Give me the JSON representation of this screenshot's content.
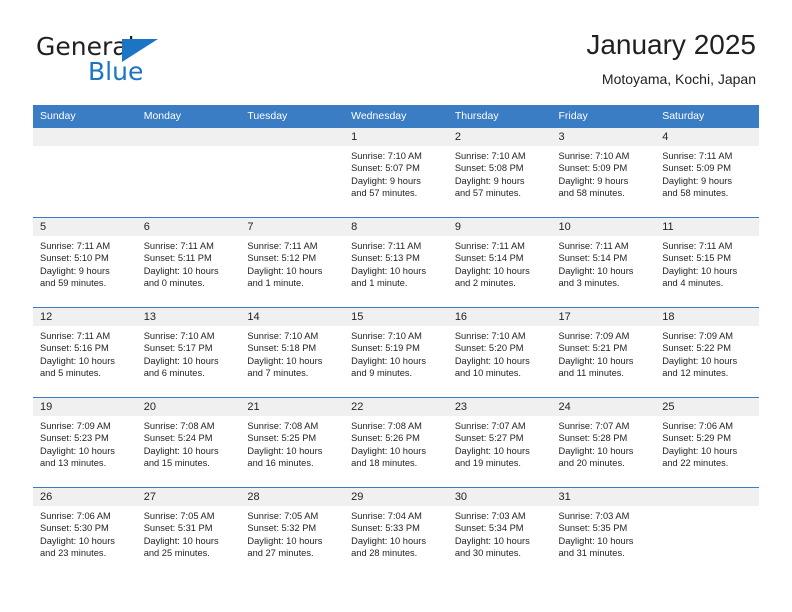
{
  "brand": {
    "name_part1": "General",
    "name_part2": "Blue",
    "triangle_icon": "triangle-icon",
    "colors": {
      "accent": "#1b74c4",
      "text": "#231f20"
    }
  },
  "header": {
    "title": "January 2025",
    "subtitle": "Motoyama, Kochi, Japan"
  },
  "theme": {
    "header_row_bg": "#3b7dc4",
    "daynum_bg": "#f0f0f0",
    "row_divider": "#3b7dc4",
    "page_bg": "#ffffff"
  },
  "weekday_headers": [
    "Sunday",
    "Monday",
    "Tuesday",
    "Wednesday",
    "Thursday",
    "Friday",
    "Saturday"
  ],
  "weeks": [
    [
      {
        "day": "",
        "sunrise": "",
        "sunset": "",
        "daylight_1": "",
        "daylight_2": "",
        "blank": true
      },
      {
        "day": "",
        "sunrise": "",
        "sunset": "",
        "daylight_1": "",
        "daylight_2": "",
        "blank": true
      },
      {
        "day": "",
        "sunrise": "",
        "sunset": "",
        "daylight_1": "",
        "daylight_2": "",
        "blank": true
      },
      {
        "day": "1",
        "sunrise": "Sunrise: 7:10 AM",
        "sunset": "Sunset: 5:07 PM",
        "daylight_1": "Daylight: 9 hours",
        "daylight_2": "and 57 minutes.",
        "blank": false
      },
      {
        "day": "2",
        "sunrise": "Sunrise: 7:10 AM",
        "sunset": "Sunset: 5:08 PM",
        "daylight_1": "Daylight: 9 hours",
        "daylight_2": "and 57 minutes.",
        "blank": false
      },
      {
        "day": "3",
        "sunrise": "Sunrise: 7:10 AM",
        "sunset": "Sunset: 5:09 PM",
        "daylight_1": "Daylight: 9 hours",
        "daylight_2": "and 58 minutes.",
        "blank": false
      },
      {
        "day": "4",
        "sunrise": "Sunrise: 7:11 AM",
        "sunset": "Sunset: 5:09 PM",
        "daylight_1": "Daylight: 9 hours",
        "daylight_2": "and 58 minutes.",
        "blank": false
      }
    ],
    [
      {
        "day": "5",
        "sunrise": "Sunrise: 7:11 AM",
        "sunset": "Sunset: 5:10 PM",
        "daylight_1": "Daylight: 9 hours",
        "daylight_2": "and 59 minutes.",
        "blank": false
      },
      {
        "day": "6",
        "sunrise": "Sunrise: 7:11 AM",
        "sunset": "Sunset: 5:11 PM",
        "daylight_1": "Daylight: 10 hours",
        "daylight_2": "and 0 minutes.",
        "blank": false
      },
      {
        "day": "7",
        "sunrise": "Sunrise: 7:11 AM",
        "sunset": "Sunset: 5:12 PM",
        "daylight_1": "Daylight: 10 hours",
        "daylight_2": "and 1 minute.",
        "blank": false
      },
      {
        "day": "8",
        "sunrise": "Sunrise: 7:11 AM",
        "sunset": "Sunset: 5:13 PM",
        "daylight_1": "Daylight: 10 hours",
        "daylight_2": "and 1 minute.",
        "blank": false
      },
      {
        "day": "9",
        "sunrise": "Sunrise: 7:11 AM",
        "sunset": "Sunset: 5:14 PM",
        "daylight_1": "Daylight: 10 hours",
        "daylight_2": "and 2 minutes.",
        "blank": false
      },
      {
        "day": "10",
        "sunrise": "Sunrise: 7:11 AM",
        "sunset": "Sunset: 5:14 PM",
        "daylight_1": "Daylight: 10 hours",
        "daylight_2": "and 3 minutes.",
        "blank": false
      },
      {
        "day": "11",
        "sunrise": "Sunrise: 7:11 AM",
        "sunset": "Sunset: 5:15 PM",
        "daylight_1": "Daylight: 10 hours",
        "daylight_2": "and 4 minutes.",
        "blank": false
      }
    ],
    [
      {
        "day": "12",
        "sunrise": "Sunrise: 7:11 AM",
        "sunset": "Sunset: 5:16 PM",
        "daylight_1": "Daylight: 10 hours",
        "daylight_2": "and 5 minutes.",
        "blank": false
      },
      {
        "day": "13",
        "sunrise": "Sunrise: 7:10 AM",
        "sunset": "Sunset: 5:17 PM",
        "daylight_1": "Daylight: 10 hours",
        "daylight_2": "and 6 minutes.",
        "blank": false
      },
      {
        "day": "14",
        "sunrise": "Sunrise: 7:10 AM",
        "sunset": "Sunset: 5:18 PM",
        "daylight_1": "Daylight: 10 hours",
        "daylight_2": "and 7 minutes.",
        "blank": false
      },
      {
        "day": "15",
        "sunrise": "Sunrise: 7:10 AM",
        "sunset": "Sunset: 5:19 PM",
        "daylight_1": "Daylight: 10 hours",
        "daylight_2": "and 9 minutes.",
        "blank": false
      },
      {
        "day": "16",
        "sunrise": "Sunrise: 7:10 AM",
        "sunset": "Sunset: 5:20 PM",
        "daylight_1": "Daylight: 10 hours",
        "daylight_2": "and 10 minutes.",
        "blank": false
      },
      {
        "day": "17",
        "sunrise": "Sunrise: 7:09 AM",
        "sunset": "Sunset: 5:21 PM",
        "daylight_1": "Daylight: 10 hours",
        "daylight_2": "and 11 minutes.",
        "blank": false
      },
      {
        "day": "18",
        "sunrise": "Sunrise: 7:09 AM",
        "sunset": "Sunset: 5:22 PM",
        "daylight_1": "Daylight: 10 hours",
        "daylight_2": "and 12 minutes.",
        "blank": false
      }
    ],
    [
      {
        "day": "19",
        "sunrise": "Sunrise: 7:09 AM",
        "sunset": "Sunset: 5:23 PM",
        "daylight_1": "Daylight: 10 hours",
        "daylight_2": "and 13 minutes.",
        "blank": false
      },
      {
        "day": "20",
        "sunrise": "Sunrise: 7:08 AM",
        "sunset": "Sunset: 5:24 PM",
        "daylight_1": "Daylight: 10 hours",
        "daylight_2": "and 15 minutes.",
        "blank": false
      },
      {
        "day": "21",
        "sunrise": "Sunrise: 7:08 AM",
        "sunset": "Sunset: 5:25 PM",
        "daylight_1": "Daylight: 10 hours",
        "daylight_2": "and 16 minutes.",
        "blank": false
      },
      {
        "day": "22",
        "sunrise": "Sunrise: 7:08 AM",
        "sunset": "Sunset: 5:26 PM",
        "daylight_1": "Daylight: 10 hours",
        "daylight_2": "and 18 minutes.",
        "blank": false
      },
      {
        "day": "23",
        "sunrise": "Sunrise: 7:07 AM",
        "sunset": "Sunset: 5:27 PM",
        "daylight_1": "Daylight: 10 hours",
        "daylight_2": "and 19 minutes.",
        "blank": false
      },
      {
        "day": "24",
        "sunrise": "Sunrise: 7:07 AM",
        "sunset": "Sunset: 5:28 PM",
        "daylight_1": "Daylight: 10 hours",
        "daylight_2": "and 20 minutes.",
        "blank": false
      },
      {
        "day": "25",
        "sunrise": "Sunrise: 7:06 AM",
        "sunset": "Sunset: 5:29 PM",
        "daylight_1": "Daylight: 10 hours",
        "daylight_2": "and 22 minutes.",
        "blank": false
      }
    ],
    [
      {
        "day": "26",
        "sunrise": "Sunrise: 7:06 AM",
        "sunset": "Sunset: 5:30 PM",
        "daylight_1": "Daylight: 10 hours",
        "daylight_2": "and 23 minutes.",
        "blank": false
      },
      {
        "day": "27",
        "sunrise": "Sunrise: 7:05 AM",
        "sunset": "Sunset: 5:31 PM",
        "daylight_1": "Daylight: 10 hours",
        "daylight_2": "and 25 minutes.",
        "blank": false
      },
      {
        "day": "28",
        "sunrise": "Sunrise: 7:05 AM",
        "sunset": "Sunset: 5:32 PM",
        "daylight_1": "Daylight: 10 hours",
        "daylight_2": "and 27 minutes.",
        "blank": false
      },
      {
        "day": "29",
        "sunrise": "Sunrise: 7:04 AM",
        "sunset": "Sunset: 5:33 PM",
        "daylight_1": "Daylight: 10 hours",
        "daylight_2": "and 28 minutes.",
        "blank": false
      },
      {
        "day": "30",
        "sunrise": "Sunrise: 7:03 AM",
        "sunset": "Sunset: 5:34 PM",
        "daylight_1": "Daylight: 10 hours",
        "daylight_2": "and 30 minutes.",
        "blank": false
      },
      {
        "day": "31",
        "sunrise": "Sunrise: 7:03 AM",
        "sunset": "Sunset: 5:35 PM",
        "daylight_1": "Daylight: 10 hours",
        "daylight_2": "and 31 minutes.",
        "blank": false
      },
      {
        "day": "",
        "sunrise": "",
        "sunset": "",
        "daylight_1": "",
        "daylight_2": "",
        "blank": true
      }
    ]
  ]
}
